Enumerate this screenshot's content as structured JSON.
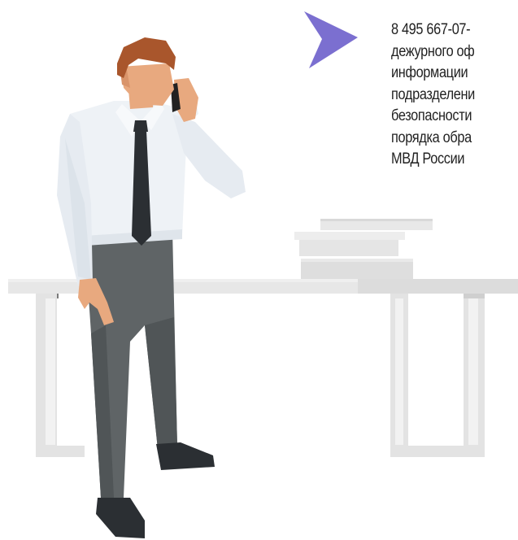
{
  "info": {
    "lines": [
      "8 495 667-07-",
      "дежурного оф",
      "информации",
      "подразделени",
      "безопасности",
      "порядка обра",
      "МВД России"
    ]
  },
  "colors": {
    "accent_arrow": "#7b6fd0",
    "table": "#e6e6e6",
    "shirt": "#e9eef4",
    "tie": "#2b2f33",
    "trousers": "#5c6163",
    "hair": "#a9562c",
    "skin": "#e8a97f"
  },
  "icons": {
    "bullet": "chevron-right-icon"
  }
}
